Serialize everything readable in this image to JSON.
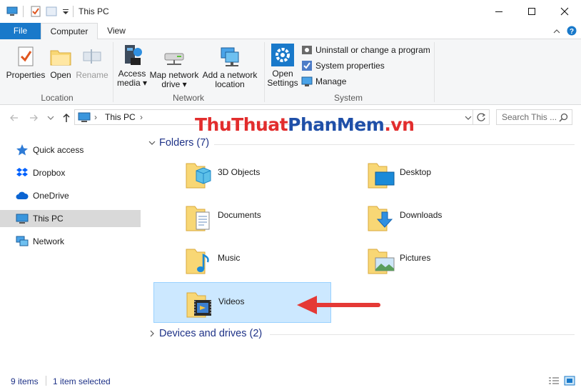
{
  "window": {
    "title": "This PC"
  },
  "ribbon_tabs": [
    "File",
    "Computer",
    "View"
  ],
  "ribbon": {
    "location": {
      "label": "Location",
      "properties": "Properties",
      "open": "Open",
      "rename": "Rename"
    },
    "network": {
      "label": "Network",
      "access_media_1": "Access",
      "access_media_2": "media",
      "map_drive_1": "Map network",
      "map_drive_2": "drive",
      "add_location_1": "Add a network",
      "add_location_2": "location"
    },
    "system": {
      "label": "System",
      "open_settings_1": "Open",
      "open_settings_2": "Settings",
      "uninstall": "Uninstall or change a program",
      "system_properties": "System properties",
      "manage": "Manage"
    }
  },
  "address": {
    "path": "This PC",
    "search_placeholder": "Search This ..."
  },
  "nav_pane": {
    "items": [
      {
        "label": "Quick access",
        "icon": "star-icon"
      },
      {
        "label": "Dropbox",
        "icon": "dropbox-icon"
      },
      {
        "label": "OneDrive",
        "icon": "cloud-icon"
      },
      {
        "label": "This PC",
        "icon": "computer-icon",
        "selected": true
      },
      {
        "label": "Network",
        "icon": "network-icon"
      }
    ]
  },
  "content": {
    "folders_header": "Folders (7)",
    "devices_header": "Devices and drives (2)",
    "folders": [
      {
        "name": "3D Objects",
        "icon": "3d-objects-icon"
      },
      {
        "name": "Desktop",
        "icon": "desktop-icon"
      },
      {
        "name": "Documents",
        "icon": "documents-icon"
      },
      {
        "name": "Downloads",
        "icon": "downloads-icon"
      },
      {
        "name": "Music",
        "icon": "music-icon"
      },
      {
        "name": "Pictures",
        "icon": "pictures-icon"
      },
      {
        "name": "Videos",
        "icon": "videos-icon",
        "selected": true
      }
    ]
  },
  "status": {
    "items_count": "9 items",
    "selected_count": "1 item selected"
  },
  "watermark": {
    "part1": "Thu",
    "part2": "Thuat",
    "part3": "PhanMem",
    "part4": ".vn"
  },
  "colors": {
    "accent": "#1979ca",
    "selection": "#cce8ff",
    "group_header": "#1e3287",
    "arrow": "#e53935",
    "folder": "#f8d775"
  }
}
